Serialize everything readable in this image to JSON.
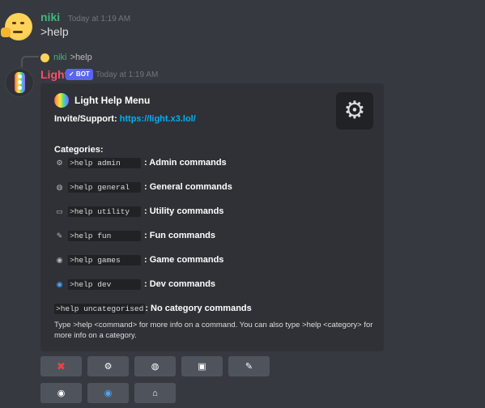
{
  "messages": [
    {
      "author": "niki",
      "timestamp": "Today at 1:19 AM",
      "text": ">help"
    }
  ],
  "reply": {
    "author": "niki",
    "text": ">help"
  },
  "bot_message": {
    "author": "Light",
    "tag": "✓ BOT",
    "timestamp": "Today at 1:19 AM",
    "embed": {
      "title": "Light Help Menu",
      "invite_label": "Invite/Support:",
      "invite_link": "https://light.x3.lol/",
      "categories_heading": "Categories:",
      "commands": [
        {
          "icon": "gear-icon",
          "glyph": "⚙",
          "cmd": ">help admin",
          "desc": ": Admin commands"
        },
        {
          "icon": "globe-icon",
          "glyph": "🌐",
          "cmd": ">help general",
          "desc": ": General commands"
        },
        {
          "icon": "box-icon",
          "glyph": "▭",
          "cmd": ">help utility",
          "desc": ": Utility commands"
        },
        {
          "icon": "magic-wand-icon",
          "glyph": "✎",
          "cmd": ">help fun",
          "desc": ": Fun commands"
        },
        {
          "icon": "gamepad-icon",
          "glyph": "◉",
          "cmd": ">help games",
          "desc": ": Game commands"
        },
        {
          "icon": "eye-icon",
          "glyph": "◉",
          "cmd": ">help dev",
          "desc": ": Dev commands"
        },
        {
          "icon": "",
          "glyph": "",
          "cmd": ">help uncategorised",
          "desc": ": No category commands"
        }
      ],
      "footer": "Type >help <command> for more info on a command. You can also type >help <category> for more info on a category."
    }
  },
  "buttons": [
    {
      "name": "close-button",
      "icon": "close-icon",
      "glyph": "✖",
      "color": "#ed4245"
    },
    {
      "name": "admin-button",
      "icon": "gear-icon",
      "glyph": "⚙",
      "color": "#ffffff"
    },
    {
      "name": "general-button",
      "icon": "globe-icon",
      "glyph": "◍",
      "color": "#ffffff"
    },
    {
      "name": "utility-button",
      "icon": "box-icon",
      "glyph": "▣",
      "color": "#ffffff"
    },
    {
      "name": "fun-button",
      "icon": "magic-wand-icon",
      "glyph": "✎",
      "color": "#ffffff"
    },
    {
      "name": "games-button",
      "icon": "gamepad-icon",
      "glyph": "◉",
      "color": "#ffffff"
    },
    {
      "name": "dev-button",
      "icon": "eye-icon",
      "glyph": "◉",
      "color": "#4aa7ff"
    },
    {
      "name": "home-button",
      "icon": "home-icon",
      "glyph": "⌂",
      "color": "#ffffff"
    }
  ],
  "colors": {
    "background": "#36393f",
    "embed": "#2f3136",
    "link": "#00aff4",
    "niki": "#43b581",
    "light": "#ff4d6d",
    "bot_tag": "#5865f2"
  }
}
